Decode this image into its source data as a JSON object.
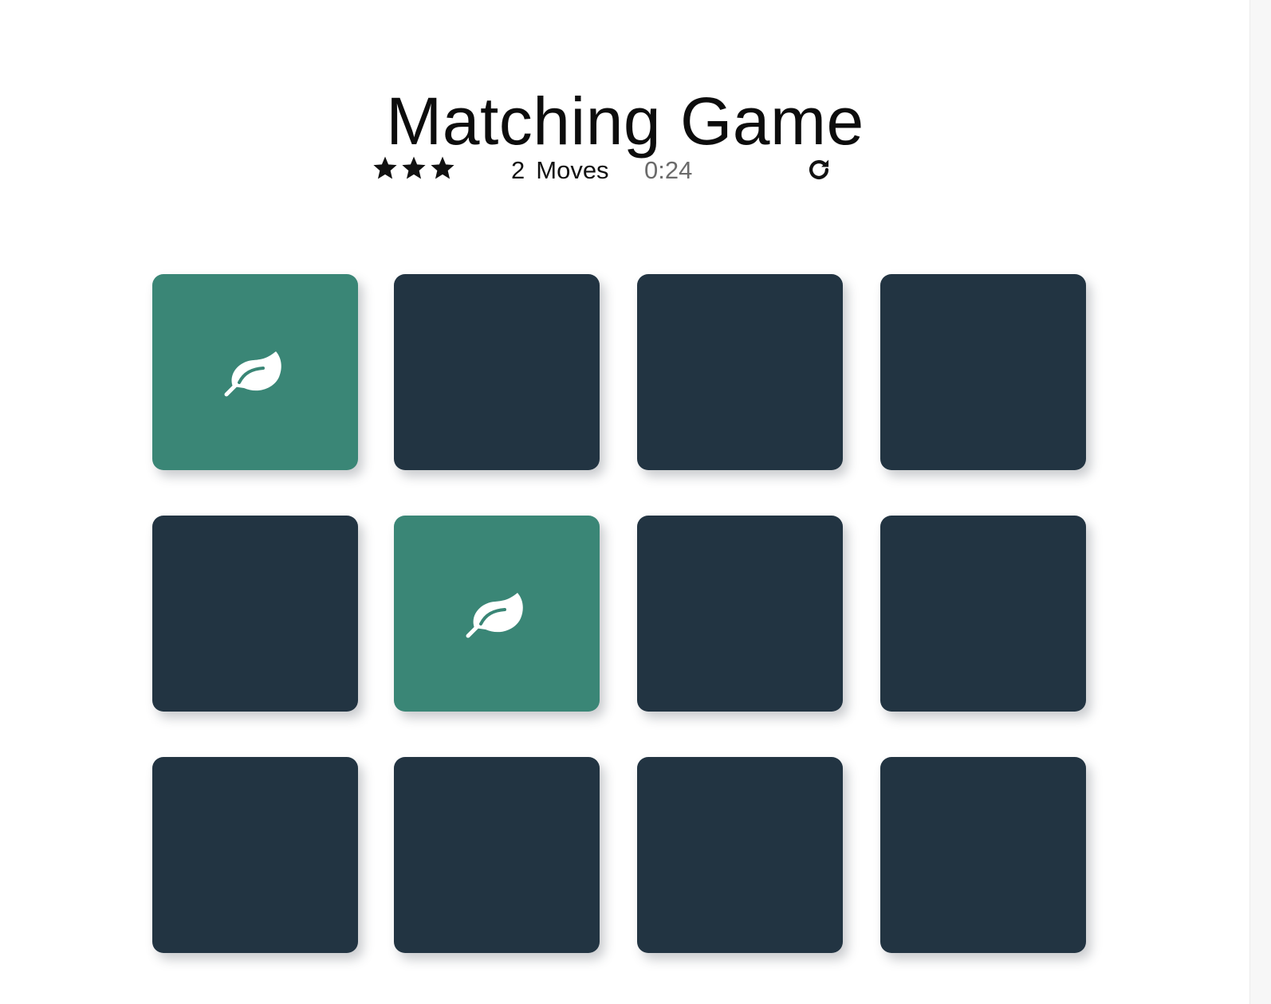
{
  "title": "Matching Game",
  "score": {
    "stars": 3,
    "moves": "2",
    "moves_label": "Moves",
    "timer": "0:24"
  },
  "colors": {
    "card_back": "#223442",
    "card_open": "#3a8676",
    "timer_text": "#6b6b6b"
  },
  "deck": [
    {
      "state": "open",
      "icon": "leaf-icon"
    },
    {
      "state": "closed",
      "icon": ""
    },
    {
      "state": "closed",
      "icon": ""
    },
    {
      "state": "closed",
      "icon": ""
    },
    {
      "state": "closed",
      "icon": ""
    },
    {
      "state": "open",
      "icon": "leaf-icon"
    },
    {
      "state": "closed",
      "icon": ""
    },
    {
      "state": "closed",
      "icon": ""
    },
    {
      "state": "closed",
      "icon": ""
    },
    {
      "state": "closed",
      "icon": ""
    },
    {
      "state": "closed",
      "icon": ""
    },
    {
      "state": "closed",
      "icon": ""
    }
  ]
}
